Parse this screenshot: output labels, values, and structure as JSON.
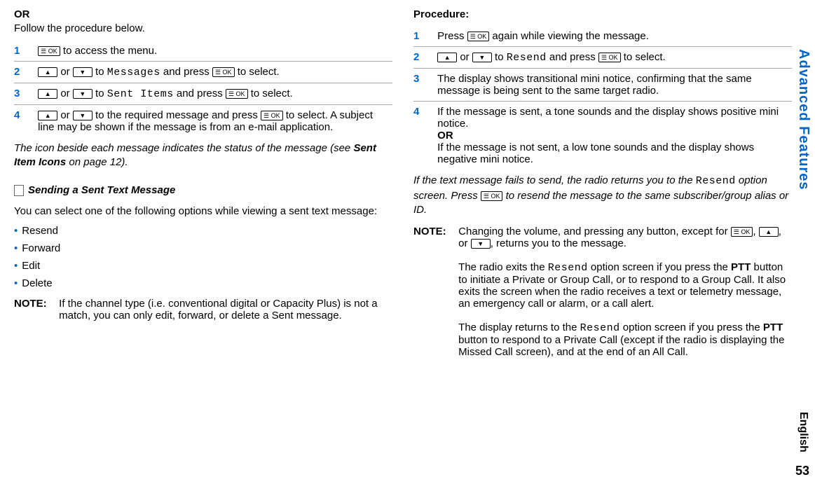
{
  "vertical_title": "Advanced Features",
  "english_label": "English",
  "page_number": "53",
  "left": {
    "or_label": "OR",
    "or_text": "Follow the procedure below.",
    "step1": " to access the menu.",
    "step2a": " or ",
    "step2b": " to ",
    "step2_menu": "Messages",
    "step2c": " and press ",
    "step2d": " to select.",
    "step3a": " or ",
    "step3b": " to ",
    "step3_menu": "Sent Items",
    "step3c": " and press ",
    "step3d": " to select.",
    "step4a": " or ",
    "step4b": " to the required message and press ",
    "step4c": " to select. A subject line may be shown if the message is from an e-mail application.",
    "footnote": "The icon beside each message indicates the status of the message (see ",
    "footnote_bold": "Sent Item Icons",
    "footnote_end": " on page 12).",
    "subheading": "Sending a Sent Text Message",
    "subtext": "You can select one of the following options while viewing a sent text message:",
    "bullets": [
      "Resend",
      "Forward",
      "Edit",
      "Delete"
    ],
    "note_label": "NOTE:",
    "note_text": "If the channel type (i.e. conventional digital or Capacity Plus) is not a match, you can only edit, forward, or delete a Sent message."
  },
  "right": {
    "procedure_label": "Procedure:",
    "step1a": "Press ",
    "step1b": " again while viewing the message.",
    "step2a": " or ",
    "step2b": " to ",
    "step2_menu": "Resend",
    "step2c": " and press ",
    "step2d": " to select.",
    "step3": "The display shows transitional mini notice, confirming that the same message is being sent to the same target radio.",
    "step4a": "If the message is sent, a tone sounds and the display shows positive mini notice.",
    "step4_or": "OR",
    "step4b": "If the message is not sent, a low tone sounds and the display shows negative mini notice.",
    "footnote1a": "If the text message fails to send, the radio returns you to the ",
    "footnote1_mono": "Resend",
    "footnote1b": " option screen. Press ",
    "footnote1c": " to resend the message to the same subscriber/group alias or ID.",
    "note_label": "NOTE:",
    "note_p1a": "Changing the volume, and pressing any button, except for ",
    "note_p1b": ", ",
    "note_p1c": ", or ",
    "note_p1d": ", returns you to the message.",
    "note_p2a": "The radio exits the ",
    "note_p2_mono": "Resend",
    "note_p2b": " option screen if you press the ",
    "note_p2_bold": "PTT",
    "note_p2c": " button to initiate a Private or Group Call, or to respond to a Group Call. It also exits the screen when the radio receives a text or telemetry message, an emergency call or alarm, or a call alert.",
    "note_p3a": "The display returns to the ",
    "note_p3_mono": "Resend",
    "note_p3b": " option screen if you press the ",
    "note_p3_bold": "PTT",
    "note_p3c": " button to respond to a Private Call (except if the radio is displaying the Missed Call screen), and at the end of an All Call."
  }
}
